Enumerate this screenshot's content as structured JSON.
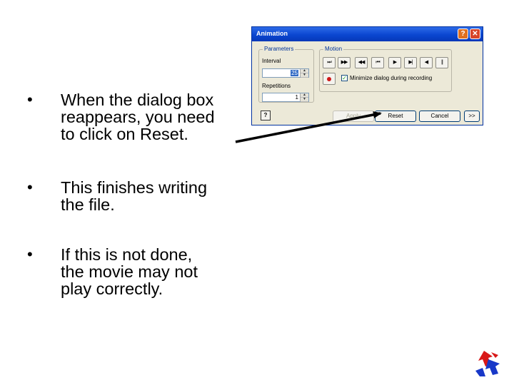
{
  "bullets": [
    {
      "marker": "•",
      "text": "When the dialog box\nreappears, you need\nto click on Reset."
    },
    {
      "marker": "•",
      "text": "This finishes writing\nthe file."
    },
    {
      "marker": "•",
      "text": "If this is not done,\nthe movie may not\nplay correctly."
    }
  ],
  "dialog": {
    "title": "Animation",
    "help_glyph": "?",
    "close_glyph": "✕",
    "parameters": {
      "group_title": "Parameters",
      "interval_label": "Interval",
      "interval_value": "25",
      "repetitions_label": "Repetitions",
      "repetitions_value": "1"
    },
    "motion": {
      "group_title": "Motion",
      "buttons": [
        "⏭",
        "▶▶",
        "◀◀",
        "⏮",
        "▶",
        "▶|",
        "◀",
        "||"
      ],
      "checkbox_label": "Minimize dialog during recording",
      "checkbox_checked": true,
      "check_glyph": "✓"
    },
    "footer": {
      "help_label": "?",
      "apply_label": "Apply",
      "reset_label": "Reset",
      "cancel_label": "Cancel",
      "more_label": ">>"
    }
  },
  "colors": {
    "title_bar": "#0a46d0",
    "dialog_bg": "#ece9d8",
    "group_title": "#003399",
    "arrow": "#000000",
    "record": "#d01818"
  }
}
